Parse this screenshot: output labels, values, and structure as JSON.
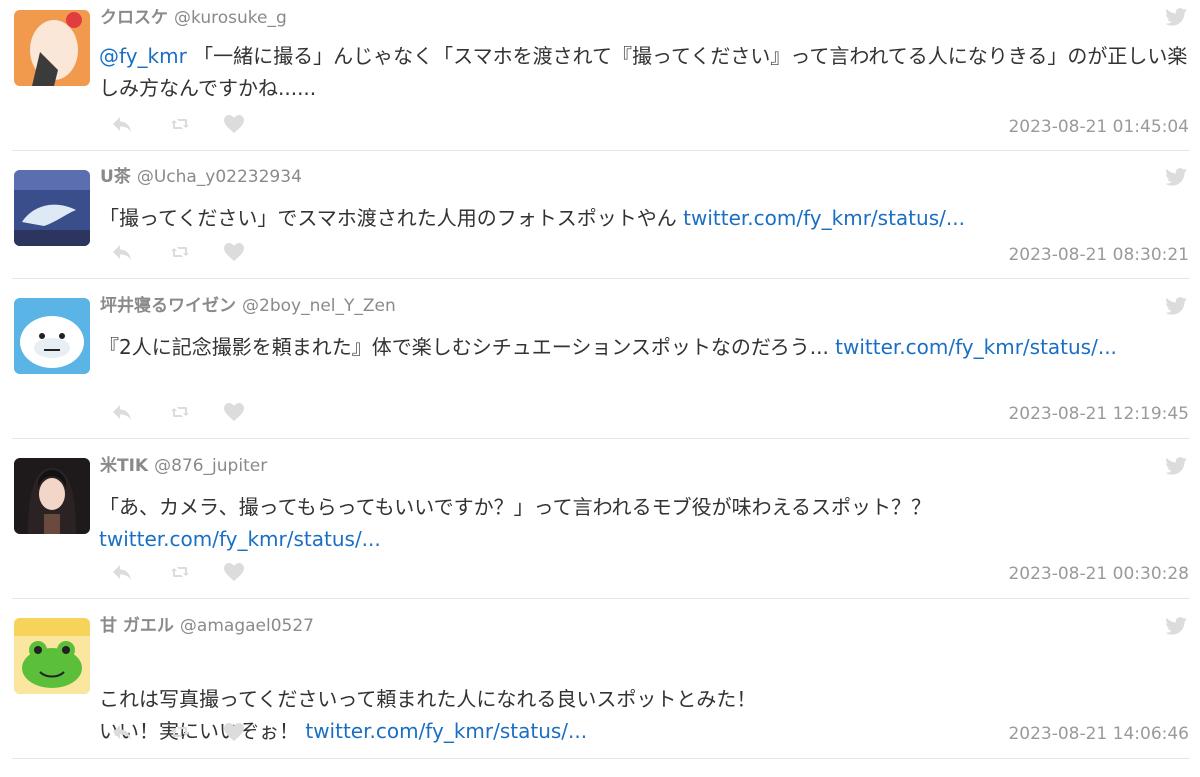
{
  "tweets": [
    {
      "name": "クロスケ",
      "handle": "@kurosuke_g",
      "mention": "@fy_kmr",
      "text": " 「一緒に撮る」んじゃなく「スマホを渡されて『撮ってください』って言われてる人になりきる」のが正しい楽しみ方なんですかね......",
      "link": "",
      "date": "2023-08-21 01:45:04",
      "avatar_icon": "fox-avatar-icon"
    },
    {
      "name": "U茶",
      "handle": "@Ucha_y02232934",
      "mention": "",
      "text": "「撮ってください」でスマホ渡された人用のフォトスポットやん ",
      "link": "twitter.com/fy_kmr/status/...",
      "date": "2023-08-21 08:30:21",
      "avatar_icon": "whale-avatar-icon"
    },
    {
      "name": "坪井寝るワイゼン",
      "handle": "@2boy_nel_Y_Zen",
      "mention": "",
      "text": "『2人に記念撮影を頼まれた』体で楽しむシチュエーションスポットなのだろう... ",
      "link": "twitter.com/fy_kmr/status/...",
      "date": "2023-08-21 12:19:45",
      "avatar_icon": "yeti-avatar-icon"
    },
    {
      "name": "米TIK",
      "handle": "@876_jupiter",
      "mention": "",
      "text": "「あ、カメラ、撮ってもらってもいいですか？」って言われるモブ役が味わえるスポット？？ ",
      "link": "twitter.com/fy_kmr/status/...",
      "date": "2023-08-21 00:30:28",
      "avatar_icon": "anime-girl-avatar-icon"
    },
    {
      "name": "甘 ガエル",
      "handle": "@amagael0527",
      "mention": "",
      "text": "これは写真撮ってくださいって頼まれた人になれる良いスポットとみた！\nいい！実にいいぞぉ！ ",
      "link": "twitter.com/fy_kmr/status/...",
      "date": "2023-08-21 14:06:46",
      "avatar_icon": "frog-avatar-icon"
    }
  ],
  "colors": {
    "link": "#1a6fc4",
    "muted": "#9a9a9a",
    "icon": "#dcdcdc",
    "divider": "#e6e6e6"
  }
}
